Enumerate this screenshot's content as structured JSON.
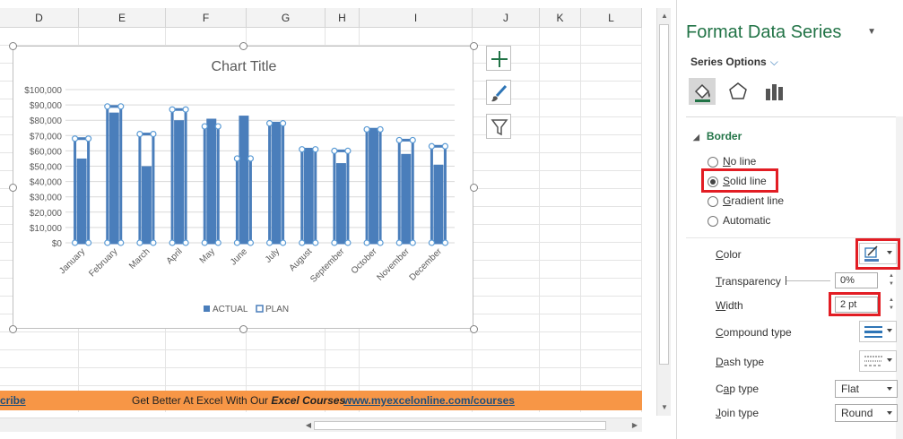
{
  "sheet": {
    "columns": [
      "D",
      "E",
      "F",
      "G",
      "H",
      "I",
      "J",
      "K",
      "L"
    ],
    "banner": {
      "subscribe": "cribe",
      "text_before": "Get Better At Excel With Our ",
      "text_emph": "Excel Courses",
      "text_after": " : ",
      "link": "www.myexcelonline.com/courses"
    }
  },
  "chart_data": {
    "type": "bar",
    "title": "Chart Title",
    "xlabel": "",
    "ylabel": "",
    "ylim": [
      0,
      100000
    ],
    "yticks": [
      "$0",
      "$10,000",
      "$20,000",
      "$30,000",
      "$40,000",
      "$50,000",
      "$60,000",
      "$70,000",
      "$80,000",
      "$90,000",
      "$100,000"
    ],
    "categories": [
      "January",
      "February",
      "March",
      "April",
      "May",
      "June",
      "July",
      "August",
      "September",
      "October",
      "November",
      "December"
    ],
    "series": [
      {
        "name": "ACTUAL",
        "values": [
          55000,
          85000,
          50000,
          80000,
          81000,
          83000,
          79000,
          62000,
          52000,
          75000,
          58000,
          51000
        ]
      },
      {
        "name": "PLAN",
        "values": [
          68000,
          89000,
          71000,
          87000,
          76000,
          55000,
          78000,
          61000,
          60000,
          74000,
          67000,
          63000
        ]
      }
    ],
    "legend_position": "bottom",
    "colors": {
      "actual": "#4a7ebb",
      "plan_outline": "#4a7ebb",
      "grid": "#d9d9d9"
    }
  },
  "chart_tools": [
    {
      "icon": "plus-icon"
    },
    {
      "icon": "brush-icon"
    },
    {
      "icon": "filter-icon"
    }
  ],
  "pane": {
    "title": "Format Data Series",
    "subtitle": "Series Options",
    "section": "Border",
    "options": {
      "no_line_prefix": "",
      "no_line_u": "N",
      "no_line_rest": "o line",
      "solid_u": "S",
      "solid_rest": "olid line",
      "gradient_u": "G",
      "gradient_rest": "radient line",
      "auto_u": "",
      "auto_rest": "Automatic",
      "selected": "Solid line"
    },
    "color_label_u": "C",
    "color_label_rest": "olor",
    "transparency_label_u": "T",
    "transparency_label_rest": "ransparency",
    "transparency_value": "0%",
    "width_label_u": "W",
    "width_label_rest": "idth",
    "width_value": "2 pt",
    "compound_label_u": "C",
    "compound_label_rest": "ompound type",
    "dash_label_u": "D",
    "dash_label_rest": "ash type",
    "cap_label_u": "a",
    "cap_label_pre": "C",
    "cap_label_rest": "p type",
    "cap_value": "Flat",
    "join_label_u": "J",
    "join_label_rest": "oin type",
    "join_value": "Round",
    "accent": "#217346",
    "highlight": "#e21d24"
  }
}
